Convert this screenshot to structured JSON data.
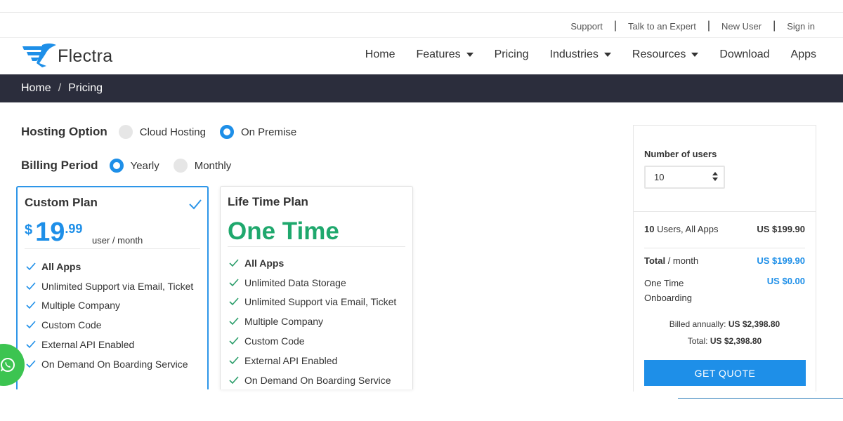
{
  "utility_nav": [
    "Support",
    "Talk to an Expert",
    "New User",
    "Sign in"
  ],
  "brand": {
    "name": "Flectra",
    "logo_color": "#1e8fe8"
  },
  "main_nav": [
    {
      "label": "Home",
      "dropdown": false
    },
    {
      "label": "Features",
      "dropdown": true
    },
    {
      "label": "Pricing",
      "dropdown": false
    },
    {
      "label": "Industries",
      "dropdown": true
    },
    {
      "label": "Resources",
      "dropdown": true
    },
    {
      "label": "Download",
      "dropdown": false
    },
    {
      "label": "Apps",
      "dropdown": false
    }
  ],
  "breadcrumb": {
    "home": "Home",
    "separator": "/",
    "current": "Pricing"
  },
  "hosting": {
    "label": "Hosting Option",
    "options": [
      {
        "label": "Cloud Hosting",
        "selected": false
      },
      {
        "label": "On Premise",
        "selected": true
      }
    ]
  },
  "billing": {
    "label": "Billing Period",
    "options": [
      {
        "label": "Yearly",
        "selected": true
      },
      {
        "label": "Monthly",
        "selected": false
      }
    ]
  },
  "custom_plan": {
    "title": "Custom Plan",
    "selected": true,
    "currency": "$",
    "price_whole": "19",
    "price_cents": ".99",
    "unit": "user / month",
    "features": [
      {
        "text": "All Apps",
        "bold": true
      },
      {
        "text": "Unlimited Support via Email, Ticket",
        "bold": false
      },
      {
        "text": "Multiple Company",
        "bold": false
      },
      {
        "text": "Custom Code",
        "bold": false
      },
      {
        "text": "External API Enabled",
        "bold": false
      },
      {
        "text": "On Demand On Boarding Service",
        "bold": false
      }
    ]
  },
  "lifetime_plan": {
    "title": "Life Time Plan",
    "headline": "One Time",
    "features": [
      {
        "text": "All Apps",
        "bold": true
      },
      {
        "text": "Unlimited Data Storage",
        "bold": false
      },
      {
        "text": "Unlimited Support via Email, Ticket",
        "bold": false
      },
      {
        "text": "Multiple Company",
        "bold": false
      },
      {
        "text": "Custom Code",
        "bold": false
      },
      {
        "text": "External API Enabled",
        "bold": false
      },
      {
        "text": "On Demand On Boarding Service",
        "bold": false
      }
    ]
  },
  "summary": {
    "users_label": "Number of users",
    "users_value": "10",
    "users_count": "10",
    "users_desc": " Users, All Apps",
    "users_price": "US $199.90",
    "total_label": "Total",
    "total_period": " / month",
    "total_value": "US $199.90",
    "onboarding_label_1": "One Time",
    "onboarding_label_2": "Onboarding",
    "onboarding_value": "US $0.00",
    "billed_label": "Billed annually: ",
    "billed_value": "US $2,398.80",
    "grand_label": "Total: ",
    "grand_value": "US $2,398.80",
    "quote_button": "GET QUOTE"
  },
  "colors": {
    "primary_blue": "#1e8fe8",
    "green": "#1fa86d",
    "breadcrumb_bg": "#2b2d3c",
    "whatsapp": "#3cc451"
  }
}
